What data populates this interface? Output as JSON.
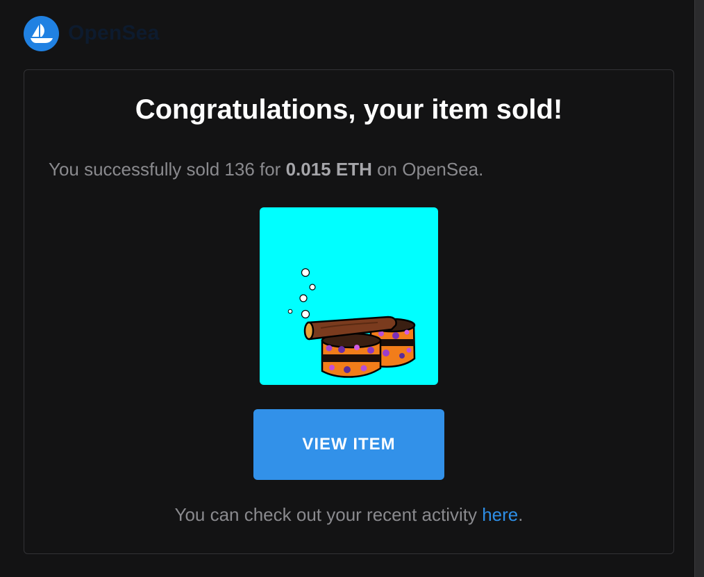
{
  "header": {
    "brand": "OpenSea",
    "logo_icon": "opensea-ship-icon",
    "logo_color": "#2081e2"
  },
  "email": {
    "title": "Congratulations, your item sold!",
    "sold_prefix": "You successfully sold 136 for ",
    "price": "0.015 ETH",
    "sold_suffix": " on OpenSea.",
    "nft_image": {
      "icon": "nft-cigar-tuna-can-image",
      "background": "#00ffff"
    },
    "button": {
      "label": "VIEW ITEM",
      "color": "#3291e9"
    },
    "activity_prefix": "You can check out your recent activity ",
    "activity_link": "here",
    "activity_suffix": "."
  }
}
